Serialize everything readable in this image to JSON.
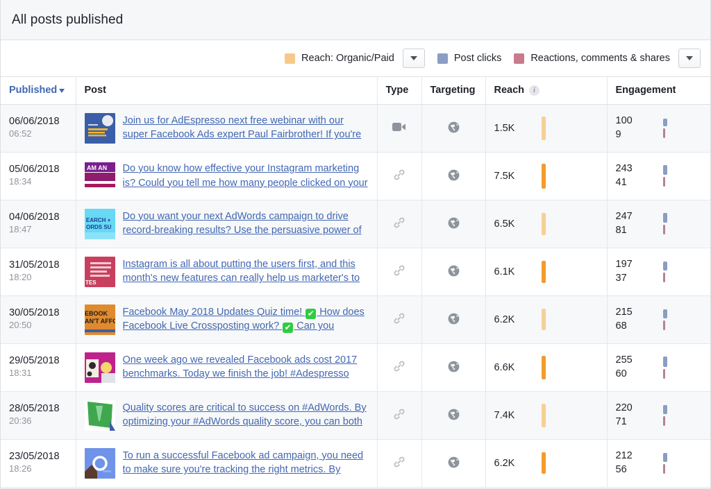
{
  "header": {
    "title": "All posts published"
  },
  "legend": {
    "items": [
      {
        "label": "Reach: Organic/Paid",
        "color": "#f5c98a",
        "name": "legend-reach"
      },
      {
        "label": "Post clicks",
        "color": "#8a9dc3",
        "name": "legend-post-clicks"
      },
      {
        "label": "Reactions, comments & shares",
        "color": "#c97b8e",
        "name": "legend-reactions"
      }
    ],
    "dropdown_icon": "chevron-down-icon"
  },
  "table": {
    "columns": [
      {
        "key": "published",
        "label": "Published",
        "sortable": true,
        "sort_icon": "caret-down-icon"
      },
      {
        "key": "post",
        "label": "Post"
      },
      {
        "key": "type",
        "label": "Type"
      },
      {
        "key": "targeting",
        "label": "Targeting"
      },
      {
        "key": "reach",
        "label": "Reach",
        "info_icon": "info-icon"
      },
      {
        "key": "engagement",
        "label": "Engagement"
      }
    ],
    "rows": [
      {
        "date": "06/06/2018",
        "time": "06:52",
        "message": "Join us for AdEspresso next free webinar with our super Facebook Ads expert Paul Fairbrother! If you're not run",
        "type_icon": "video-camera-icon",
        "targeting_icon": "globe-icon",
        "reach": "1.5K",
        "reach_bar_h": 34,
        "reach_bar_style": "light",
        "post_clicks": "100",
        "reactions": "9",
        "clicks_bar_h": 11,
        "reactions_bar_h": 14
      },
      {
        "date": "05/06/2018",
        "time": "18:34",
        "message": "Do you know how effective your Instagram marketing is? Could you tell me how many people clicked on your",
        "type_icon": "link-icon",
        "targeting_icon": "globe-icon",
        "reach": "7.5K",
        "reach_bar_h": 36,
        "reach_bar_style": "solid",
        "post_clicks": "243",
        "reactions": "41",
        "clicks_bar_h": 14,
        "reactions_bar_h": 14
      },
      {
        "date": "04/06/2018",
        "time": "18:47",
        "message": "Do you want your next AdWords campaign to drive record-breaking results? Use the persuasive power of video!",
        "type_icon": "link-icon",
        "targeting_icon": "globe-icon",
        "reach": "6.5K",
        "reach_bar_h": 32,
        "reach_bar_style": "light",
        "post_clicks": "247",
        "reactions": "81",
        "clicks_bar_h": 14,
        "reactions_bar_h": 14
      },
      {
        "date": "31/05/2018",
        "time": "18:20",
        "message": "Instagram is all about putting the users first, and this month's new features can really help us marketer's to serve",
        "type_icon": "link-icon",
        "targeting_icon": "globe-icon",
        "reach": "6.1K",
        "reach_bar_h": 32,
        "reach_bar_style": "solid",
        "post_clicks": "197",
        "reactions": "37",
        "clicks_bar_h": 13,
        "reactions_bar_h": 14
      },
      {
        "date": "30/05/2018",
        "time": "20:50",
        "message": "Facebook May 2018 Updates Quiz time! ✅  How does Facebook Live Crossposting work? ✅  Can you (finally)",
        "type_icon": "link-icon",
        "targeting_icon": "globe-icon",
        "reach": "6.2K",
        "reach_bar_h": 31,
        "reach_bar_style": "light",
        "post_clicks": "215",
        "reactions": "68",
        "clicks_bar_h": 13,
        "reactions_bar_h": 14
      },
      {
        "date": "29/05/2018",
        "time": "18:31",
        "message": "One week ago we revealed Facebook ads cost 2017 benchmarks. Today we finish the job! #Adespresso data a",
        "type_icon": "link-icon",
        "targeting_icon": "globe-icon",
        "reach": "6.6K",
        "reach_bar_h": 34,
        "reach_bar_style": "solid",
        "post_clicks": "255",
        "reactions": "60",
        "clicks_bar_h": 15,
        "reactions_bar_h": 14
      },
      {
        "date": "28/05/2018",
        "time": "20:36",
        "message": "Quality scores are critical to success on #AdWords. By optimizing your #AdWords quality score, you can both r",
        "type_icon": "link-icon",
        "targeting_icon": "globe-icon",
        "reach": "7.4K",
        "reach_bar_h": 34,
        "reach_bar_style": "light",
        "post_clicks": "220",
        "reactions": "71",
        "clicks_bar_h": 13,
        "reactions_bar_h": 14
      },
      {
        "date": "23/05/2018",
        "time": "18:26",
        "message": "To run a successful Facebook ad campaign, you need to make sure you're tracking the right metrics. By manag",
        "type_icon": "link-icon",
        "targeting_icon": "globe-icon",
        "reach": "6.2K",
        "reach_bar_h": 31,
        "reach_bar_style": "solid",
        "post_clicks": "212",
        "reactions": "56",
        "clicks_bar_h": 13,
        "reactions_bar_h": 14
      }
    ]
  },
  "colors": {
    "reach_solid": "#f39c2a",
    "reach_light": "#f8cf96",
    "clicks": "#8a9dc3",
    "reactions": "#b4838f",
    "link_blue": "#4267b2"
  }
}
